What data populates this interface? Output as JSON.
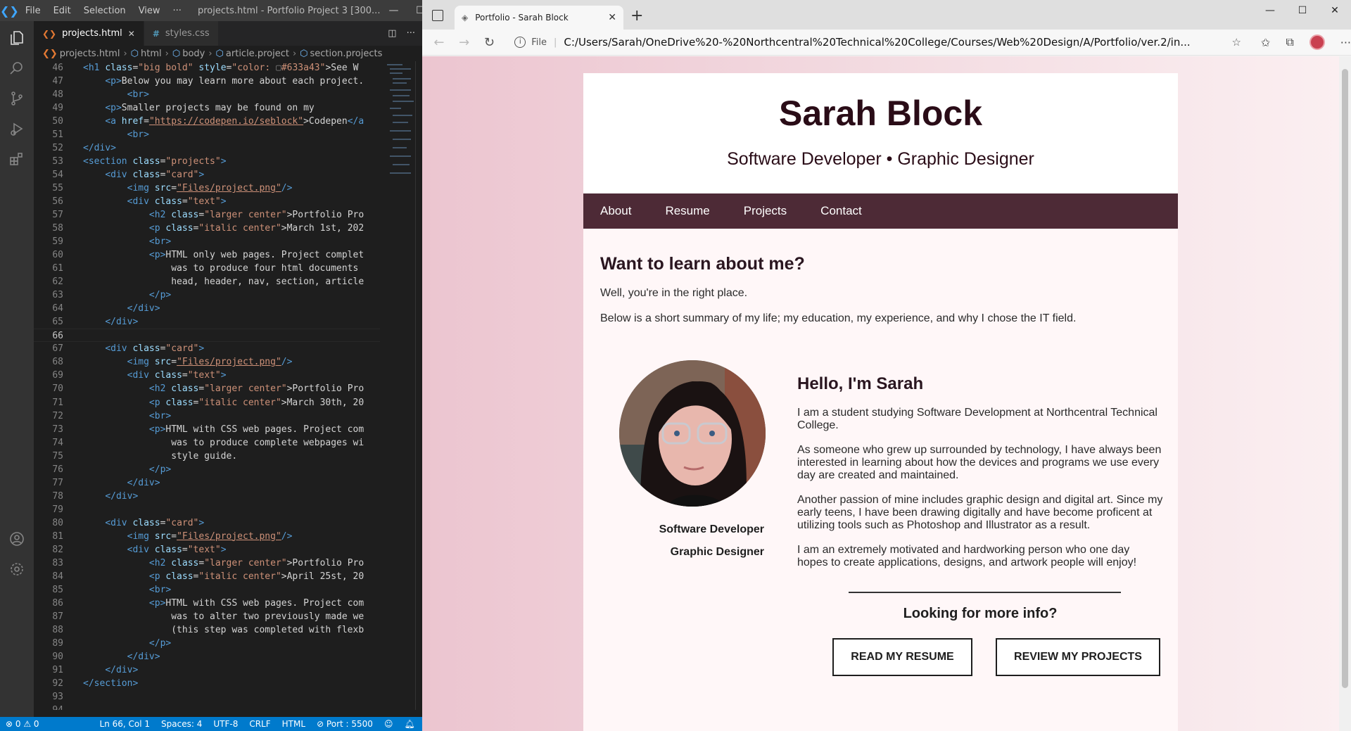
{
  "vscode": {
    "menu": [
      "File",
      "Edit",
      "Selection",
      "View",
      "···"
    ],
    "window_title": "projects.html - Portfolio Project 3 [300...",
    "tabs": [
      {
        "label": "projects.html",
        "active": true
      },
      {
        "label": "styles.css",
        "active": false
      }
    ],
    "breadcrumb": [
      "projects.html",
      "html",
      "body",
      "article.project",
      "section.projects"
    ],
    "status": {
      "problems": "⊗ 0 ⚠ 0",
      "position": "Ln 66, Col 1",
      "spaces": "Spaces: 4",
      "encoding": "UTF-8",
      "eol": "CRLF",
      "language": "HTML",
      "port": "⊘ Port : 5500"
    },
    "lines": [
      {
        "n": "46",
        "html": "<span class=\"t\">&lt;h1</span> <span class=\"a\">class</span>=<span class=\"s\">\"big bold\"</span> <span class=\"a\">style</span>=<span class=\"s\">\"color: </span><span class=\"p\">▢</span><span class=\"s\">#633a43\"</span>&gt;See W"
      },
      {
        "n": "47",
        "html": "    <span class=\"t\">&lt;p&gt;</span>Below you may learn more about each project."
      },
      {
        "n": "48",
        "html": "        <span class=\"t\">&lt;br&gt;</span>"
      },
      {
        "n": "49",
        "html": "    <span class=\"t\">&lt;p&gt;</span>Smaller projects may be found on my"
      },
      {
        "n": "50",
        "html": "    <span class=\"t\">&lt;a</span> <span class=\"a\">href</span>=<span class=\"u\">\"https://codepen.io/seblock\"</span>&gt;Codepen<span class=\"t\">&lt;/a</span>"
      },
      {
        "n": "51",
        "html": "        <span class=\"t\">&lt;br&gt;</span>"
      },
      {
        "n": "52",
        "html": "<span class=\"t\">&lt;/div&gt;</span>"
      },
      {
        "n": "53",
        "html": "<span class=\"t\">&lt;section</span> <span class=\"a\">class</span>=<span class=\"s\">\"projects\"</span><span class=\"t\">&gt;</span>"
      },
      {
        "n": "54",
        "html": "    <span class=\"t\">&lt;div</span> <span class=\"a\">class</span>=<span class=\"s\">\"card\"</span><span class=\"t\">&gt;</span>"
      },
      {
        "n": "55",
        "html": "        <span class=\"t\">&lt;img</span> <span class=\"a\">src</span>=<span class=\"u\">\"Files/project.png\"</span><span class=\"t\">/&gt;</span>"
      },
      {
        "n": "56",
        "html": "        <span class=\"t\">&lt;div</span> <span class=\"a\">class</span>=<span class=\"s\">\"text\"</span><span class=\"t\">&gt;</span>"
      },
      {
        "n": "57",
        "html": "            <span class=\"t\">&lt;h2</span> <span class=\"a\">class</span>=<span class=\"s\">\"larger center\"</span>&gt;Portfolio Pro"
      },
      {
        "n": "58",
        "html": "            <span class=\"t\">&lt;p</span> <span class=\"a\">class</span>=<span class=\"s\">\"italic center\"</span>&gt;March 1st, 202"
      },
      {
        "n": "59",
        "html": "            <span class=\"t\">&lt;br&gt;</span>"
      },
      {
        "n": "60",
        "html": "            <span class=\"t\">&lt;p&gt;</span>HTML only web pages. Project complet"
      },
      {
        "n": "61",
        "html": "                was to produce four html documents"
      },
      {
        "n": "62",
        "html": "                head, header, nav, section, article"
      },
      {
        "n": "63",
        "html": "            <span class=\"t\">&lt;/p&gt;</span>"
      },
      {
        "n": "64",
        "html": "        <span class=\"t\">&lt;/div&gt;</span>"
      },
      {
        "n": "65",
        "html": "    <span class=\"t\">&lt;/div&gt;</span>"
      },
      {
        "n": "66",
        "html": ""
      },
      {
        "n": "67",
        "html": "    <span class=\"t\">&lt;div</span> <span class=\"a\">class</span>=<span class=\"s\">\"card\"</span><span class=\"t\">&gt;</span>"
      },
      {
        "n": "68",
        "html": "        <span class=\"t\">&lt;img</span> <span class=\"a\">src</span>=<span class=\"u\">\"Files/project.png\"</span><span class=\"t\">/&gt;</span>"
      },
      {
        "n": "69",
        "html": "        <span class=\"t\">&lt;div</span> <span class=\"a\">class</span>=<span class=\"s\">\"text\"</span><span class=\"t\">&gt;</span>"
      },
      {
        "n": "70",
        "html": "            <span class=\"t\">&lt;h2</span> <span class=\"a\">class</span>=<span class=\"s\">\"larger center\"</span>&gt;Portfolio Pro"
      },
      {
        "n": "71",
        "html": "            <span class=\"t\">&lt;p</span> <span class=\"a\">class</span>=<span class=\"s\">\"italic center\"</span>&gt;March 30th, 20"
      },
      {
        "n": "72",
        "html": "            <span class=\"t\">&lt;br&gt;</span>"
      },
      {
        "n": "73",
        "html": "            <span class=\"t\">&lt;p&gt;</span>HTML with CSS web pages. Project com"
      },
      {
        "n": "74",
        "html": "                was to produce complete webpages wi"
      },
      {
        "n": "75",
        "html": "                style guide."
      },
      {
        "n": "76",
        "html": "            <span class=\"t\">&lt;/p&gt;</span>"
      },
      {
        "n": "77",
        "html": "        <span class=\"t\">&lt;/div&gt;</span>"
      },
      {
        "n": "78",
        "html": "    <span class=\"t\">&lt;/div&gt;</span>"
      },
      {
        "n": "79",
        "html": ""
      },
      {
        "n": "80",
        "html": "    <span class=\"t\">&lt;div</span> <span class=\"a\">class</span>=<span class=\"s\">\"card\"</span><span class=\"t\">&gt;</span>"
      },
      {
        "n": "81",
        "html": "        <span class=\"t\">&lt;img</span> <span class=\"a\">src</span>=<span class=\"u\">\"Files/project.png\"</span><span class=\"t\">/&gt;</span>"
      },
      {
        "n": "82",
        "html": "        <span class=\"t\">&lt;div</span> <span class=\"a\">class</span>=<span class=\"s\">\"text\"</span><span class=\"t\">&gt;</span>"
      },
      {
        "n": "83",
        "html": "            <span class=\"t\">&lt;h2</span> <span class=\"a\">class</span>=<span class=\"s\">\"larger center\"</span>&gt;Portfolio Pro"
      },
      {
        "n": "84",
        "html": "            <span class=\"t\">&lt;p</span> <span class=\"a\">class</span>=<span class=\"s\">\"italic center\"</span>&gt;April 25st, 20"
      },
      {
        "n": "85",
        "html": "            <span class=\"t\">&lt;br&gt;</span>"
      },
      {
        "n": "86",
        "html": "            <span class=\"t\">&lt;p&gt;</span>HTML with CSS web pages. Project com"
      },
      {
        "n": "87",
        "html": "                was to alter two previously made we"
      },
      {
        "n": "88",
        "html": "                (this step was completed with flexb"
      },
      {
        "n": "89",
        "html": "            <span class=\"t\">&lt;/p&gt;</span>"
      },
      {
        "n": "90",
        "html": "        <span class=\"t\">&lt;/div&gt;</span>"
      },
      {
        "n": "91",
        "html": "    <span class=\"t\">&lt;/div&gt;</span>"
      },
      {
        "n": "92",
        "html": "<span class=\"t\">&lt;/section&gt;</span>"
      },
      {
        "n": "93",
        "html": ""
      },
      {
        "n": "94",
        "html": ""
      }
    ]
  },
  "browser": {
    "tab_title": "Portfolio - Sarah Block",
    "address_prefix": "File",
    "url": "C:/Users/Sarah/OneDrive%20-%20Northcentral%20Technical%20College/Courses/Web%20Design/A/Portfolio/ver.2/in...",
    "page": {
      "title": "Sarah Block",
      "subtitle": "Software Developer • Graphic Designer",
      "nav": [
        "About",
        "Resume",
        "Projects",
        "Contact"
      ],
      "intro_heading": "Want to learn about me?",
      "intro_p1": "Well, you're in the right place.",
      "intro_p2": "Below is a short summary of my life; my education, my experience, and why I chose the IT field.",
      "caption1": "Software Developer",
      "caption2": "Graphic Designer",
      "bio_heading": "Hello, I'm Sarah",
      "bio": [
        "I am a student studying Software Development at Northcentral Technical College.",
        "As someone who grew up surrounded by technology, I have always been interested in learning about how the devices and programs we use every day are created and maintained.",
        "Another passion of mine includes graphic design and digital art. Since my early teens, I have been drawing digitally and have become proficent at utilizing tools such as Photoshop and Illustrator as a result.",
        "I am an extremely motivated and hardworking person who one day hopes to create applications, designs, and artwork people will enjoy!"
      ],
      "more_heading": "Looking for more info?",
      "btn_resume": "READ MY RESUME",
      "btn_projects": "REVIEW MY PROJECTS"
    }
  },
  "colors": {
    "nav_bg": "#4d2a36",
    "title_color": "#2a0c17",
    "vscode_status": "#007acc"
  }
}
